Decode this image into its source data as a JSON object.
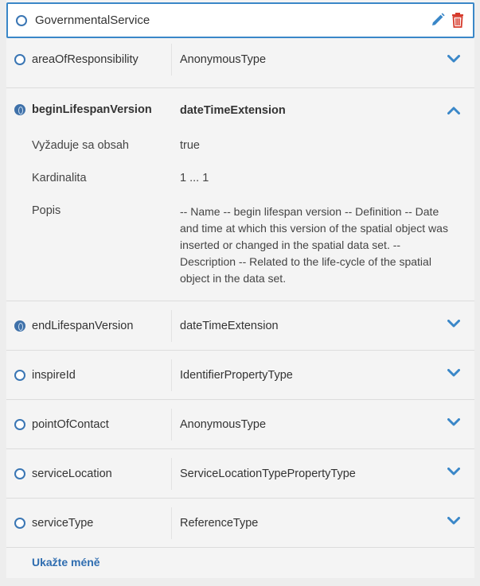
{
  "header": {
    "title": "GovernmentalService",
    "icons": {
      "edit": "pencil-icon",
      "delete": "trash-icon"
    },
    "colors": {
      "edit": "#3a87c8",
      "delete": "#d63a2b",
      "border": "#3a87c8"
    }
  },
  "rows": [
    {
      "name": "areaOfResponsibility",
      "type": "AnonymousType",
      "filled": false
    },
    {
      "name": "endLifespanVersion",
      "type": "dateTimeExtension",
      "filled": true
    },
    {
      "name": "inspireId",
      "type": "IdentifierPropertyType",
      "filled": false
    },
    {
      "name": "pointOfContact",
      "type": "AnonymousType",
      "filled": false
    },
    {
      "name": "serviceLocation",
      "type": "ServiceLocationTypePropertyType",
      "filled": false
    },
    {
      "name": "serviceType",
      "type": "ReferenceType",
      "filled": false
    }
  ],
  "expanded": {
    "name": "beginLifespanVersion",
    "type": "dateTimeExtension",
    "details": {
      "required_label": "Vyžaduje sa obsah",
      "required_value": "true",
      "cardinality_label": "Kardinalita",
      "cardinality_value": "1 ... 1",
      "description_label": "Popis",
      "description_value": "-- Name -- begin lifespan version -- Definition -- Date and time at which this version of the spatial object was inserted or changed in the spatial data set. -- Description -- Related to the life-cycle of the spatial object in the data set."
    }
  },
  "footer": {
    "show_less_label": "Ukažte méně"
  }
}
